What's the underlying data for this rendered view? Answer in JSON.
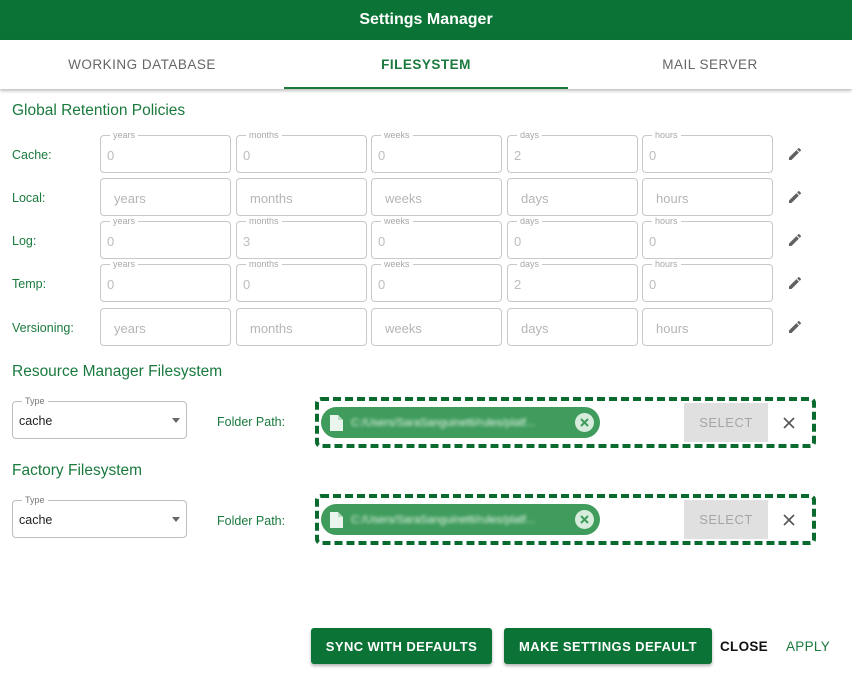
{
  "window": {
    "title": "Settings Manager"
  },
  "tabs": [
    {
      "label": "WORKING DATABASE",
      "active": false
    },
    {
      "label": "FILESYSTEM",
      "active": true
    },
    {
      "label": "MAIL SERVER",
      "active": false
    }
  ],
  "retention": {
    "title": "Global Retention Policies",
    "field_names": [
      "years",
      "months",
      "weeks",
      "days",
      "hours"
    ],
    "rows": [
      {
        "label": "Cache:",
        "values": [
          "0",
          "0",
          "0",
          "2",
          "0"
        ]
      },
      {
        "label": "Local:",
        "values": [
          "",
          "",
          "",
          "",
          ""
        ]
      },
      {
        "label": "Log:",
        "values": [
          "0",
          "3",
          "0",
          "0",
          "0"
        ]
      },
      {
        "label": "Temp:",
        "values": [
          "0",
          "0",
          "0",
          "2",
          "0"
        ]
      },
      {
        "label": "Versioning:",
        "values": [
          "",
          "",
          "",
          "",
          ""
        ]
      }
    ],
    "edit_icon": "pencil-icon"
  },
  "resource_fs": {
    "title": "Resource Manager Filesystem",
    "type_label": "Type",
    "type_value": "cache",
    "folder_label": "Folder Path:",
    "path": "C:/Users/SaraSanguinetti/rules/platf...",
    "select_label": "SELECT"
  },
  "factory_fs": {
    "title": "Factory Filesystem",
    "type_label": "Type",
    "type_value": "cache",
    "folder_label": "Folder Path:",
    "path": "C:/Users/SaraSanguinetti/rules/platf...",
    "select_label": "SELECT"
  },
  "footer": {
    "sync_label": "SYNC WITH DEFAULTS",
    "make_default_label": "MAKE SETTINGS DEFAULT",
    "close_label": "CLOSE",
    "apply_label": "APPLY"
  },
  "colors": {
    "primary": "#0b7335",
    "accent_text": "#1a7a3e",
    "chip": "#3f9c5c"
  }
}
